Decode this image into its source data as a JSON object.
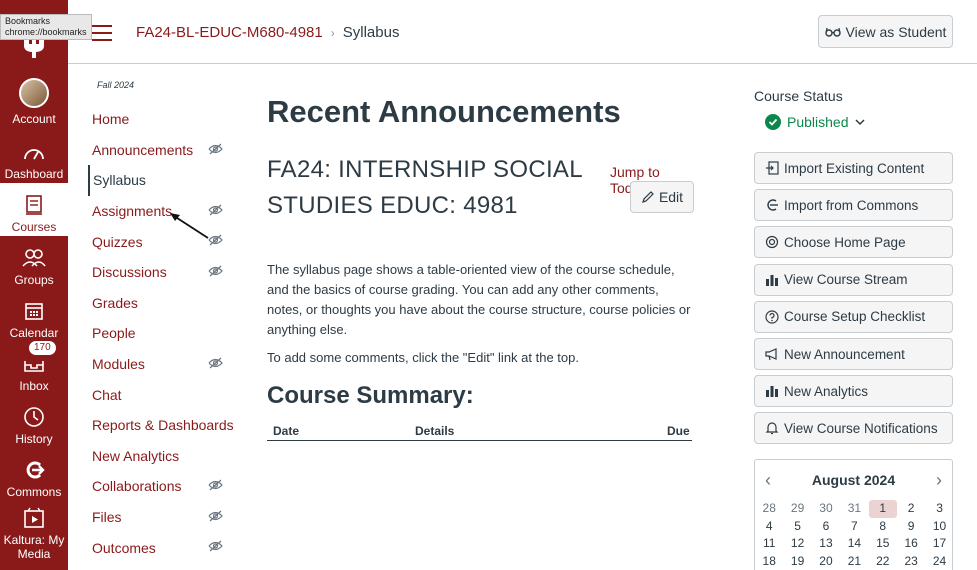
{
  "tooltip": {
    "line1": "Bookmarks",
    "line2": "chrome://bookmarks"
  },
  "global_nav": [
    {
      "label": "Account",
      "icon": "avatar"
    },
    {
      "label": "Dashboard",
      "icon": "dashboard-icon"
    },
    {
      "label": "Courses",
      "icon": "courses-icon"
    },
    {
      "label": "Groups",
      "icon": "groups-icon"
    },
    {
      "label": "Calendar",
      "icon": "calendar-icon"
    },
    {
      "label": "Inbox",
      "icon": "inbox-icon",
      "badge": "170"
    },
    {
      "label": "History",
      "icon": "history-icon"
    },
    {
      "label": "Commons",
      "icon": "commons-icon"
    },
    {
      "label": "Kaltura: My Media",
      "icon": "kaltura-icon"
    }
  ],
  "header": {
    "course": "FA24-BL-EDUC-M680-4981",
    "separator": "›",
    "page": "Syllabus",
    "view_as_student": "View as Student"
  },
  "course_nav": {
    "term": "Fall 2024",
    "items": [
      {
        "label": "Home",
        "hidden": false
      },
      {
        "label": "Announcements",
        "hidden": true
      },
      {
        "label": "Syllabus",
        "hidden": false,
        "active": true
      },
      {
        "label": "Assignments",
        "hidden": true
      },
      {
        "label": "Quizzes",
        "hidden": true
      },
      {
        "label": "Discussions",
        "hidden": true
      },
      {
        "label": "Grades",
        "hidden": false
      },
      {
        "label": "People",
        "hidden": false
      },
      {
        "label": "Modules",
        "hidden": true
      },
      {
        "label": "Chat",
        "hidden": false
      },
      {
        "label": "Reports & Dashboards",
        "hidden": false
      },
      {
        "label": "New Analytics",
        "hidden": false
      },
      {
        "label": "Collaborations",
        "hidden": true
      },
      {
        "label": "Files",
        "hidden": true
      },
      {
        "label": "Outcomes",
        "hidden": true
      }
    ]
  },
  "main": {
    "heading": "Recent Announcements",
    "syllabus_title": "FA24: INTERNSHIP SOCIAL STUDIES EDUC: 4981",
    "jump_to_today": "Jump to Today",
    "edit": "Edit",
    "description": "The syllabus page shows a table-oriented view of the course schedule, and the basics of course grading. You can add any other comments, notes, or thoughts you have about the course structure, course policies or anything else.",
    "description2": "To add some comments, click the \"Edit\" link at the top.",
    "summary_heading": "Course Summary:",
    "table_headers": {
      "date": "Date",
      "details": "Details",
      "due": "Due"
    }
  },
  "sidebar": {
    "status_title": "Course Status",
    "published": "Published",
    "buttons": [
      {
        "label": "Import Existing Content",
        "icon": "import-icon"
      },
      {
        "label": "Import from Commons",
        "icon": "commons-import-icon"
      },
      {
        "label": "Choose Home Page",
        "icon": "target-icon"
      },
      {
        "label": "View Course Stream",
        "icon": "bar-chart-icon"
      },
      {
        "label": "Course Setup Checklist",
        "icon": "question-icon"
      },
      {
        "label": "New Announcement",
        "icon": "megaphone-icon"
      },
      {
        "label": "New Analytics",
        "icon": "bar-chart-icon"
      },
      {
        "label": "View Course Notifications",
        "icon": "bell-icon"
      }
    ],
    "calendar": {
      "month": "August 2024",
      "prev": "‹",
      "next": "›",
      "days": [
        {
          "d": "28",
          "other": true
        },
        {
          "d": "29",
          "other": true
        },
        {
          "d": "30",
          "other": true
        },
        {
          "d": "31",
          "other": true
        },
        {
          "d": "1",
          "today": true
        },
        {
          "d": "2"
        },
        {
          "d": "3"
        },
        {
          "d": "4"
        },
        {
          "d": "5"
        },
        {
          "d": "6"
        },
        {
          "d": "7"
        },
        {
          "d": "8"
        },
        {
          "d": "9"
        },
        {
          "d": "10"
        },
        {
          "d": "11"
        },
        {
          "d": "12"
        },
        {
          "d": "13"
        },
        {
          "d": "14"
        },
        {
          "d": "15"
        },
        {
          "d": "16"
        },
        {
          "d": "17"
        },
        {
          "d": "18"
        },
        {
          "d": "19"
        },
        {
          "d": "20"
        },
        {
          "d": "21"
        },
        {
          "d": "22"
        },
        {
          "d": "23"
        },
        {
          "d": "24"
        }
      ]
    }
  },
  "colors": {
    "brand": "#8a1a1a",
    "text": "#2d3b45",
    "published": "#0b874b"
  }
}
